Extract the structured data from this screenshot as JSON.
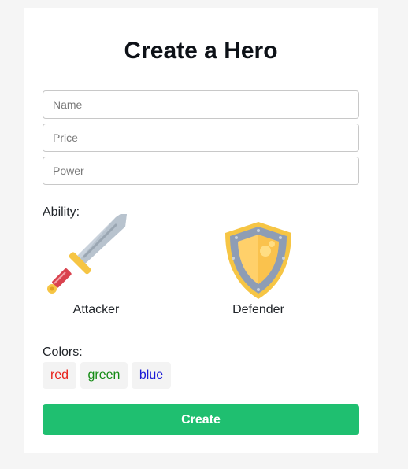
{
  "form": {
    "title": "Create a Hero",
    "fields": {
      "name_placeholder": "Name",
      "price_placeholder": "Price",
      "power_placeholder": "Power",
      "name_value": "",
      "price_value": "",
      "power_value": ""
    },
    "ability": {
      "label": "Ability:",
      "options": [
        {
          "label": "Attacker",
          "icon": "sword-icon"
        },
        {
          "label": "Defender",
          "icon": "shield-icon"
        }
      ]
    },
    "colors": {
      "label": "Colors:",
      "options": [
        {
          "label": "red",
          "color": "#e8211a"
        },
        {
          "label": "green",
          "color": "#128a12"
        },
        {
          "label": "blue",
          "color": "#1a1ad6"
        }
      ]
    },
    "submit_label": "Create",
    "accent_color": "#1fbf70"
  }
}
